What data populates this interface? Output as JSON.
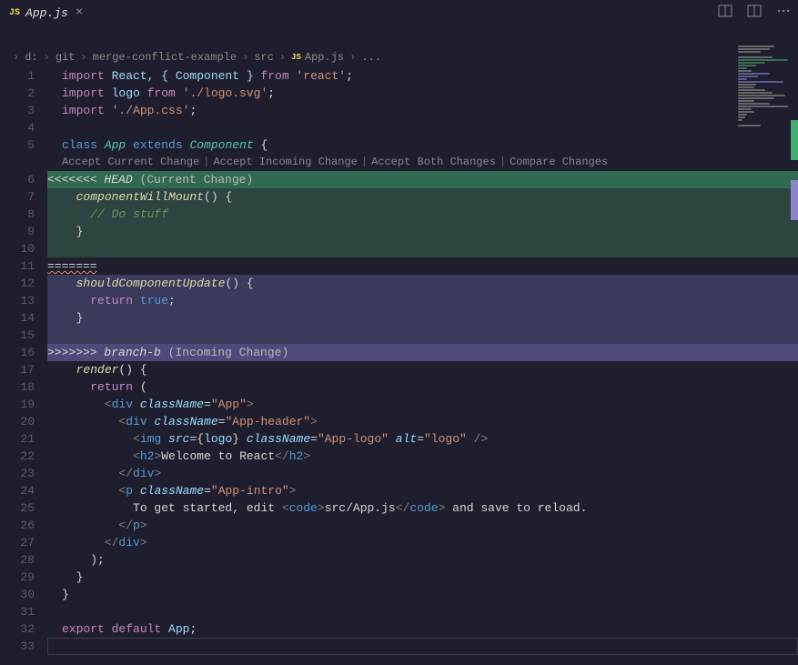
{
  "tab": {
    "icon_text": "JS",
    "filename": "App.js"
  },
  "top_icons": {
    "split": "split-editor",
    "layout": "editor-layout",
    "more": "more-actions"
  },
  "breadcrumb": {
    "items": [
      "d:",
      "git",
      "merge-conflict-example",
      "src"
    ],
    "file_icon": "JS",
    "file": "App.js",
    "trailing": "..."
  },
  "codelens": {
    "accept_current": "Accept Current Change",
    "accept_incoming": "Accept Incoming Change",
    "accept_both": "Accept Both Changes",
    "compare": "Compare Changes"
  },
  "conflict": {
    "head_marker": "<<<<<<< ",
    "head_label": "HEAD",
    "head_suffix": " (Current Change)",
    "separator": "=======",
    "incoming_marker": ">>>>>>> ",
    "incoming_label": "branch-b",
    "incoming_suffix": " (Incoming Change)"
  },
  "lines": {
    "l1_kw": "import",
    "l1_rest": " React, { Component } ",
    "l1_from": "from",
    "l1_str": " 'react'",
    "l2_kw": "import",
    "l2_var": " logo ",
    "l2_from": "from",
    "l2_str": " './logo.svg'",
    "l3_kw": "import",
    "l3_str": " './App.css'",
    "l5_class": "class",
    "l5_name": " App ",
    "l5_extends": "extends",
    "l5_comp": " Component ",
    "l7_fn": "componentWillMount",
    "l8_com": "// Do stuff",
    "l12_fn": "shouldComponentUpdate",
    "l13_ret": "return",
    "l13_true": " true",
    "l17_fn": "render",
    "l18_ret": "return",
    "l19_div": "div",
    "l19_cn": "className",
    "l19_val": "\"App\"",
    "l20_div": "div",
    "l20_cn": "className",
    "l20_val": "\"App-header\"",
    "l21_img": "img",
    "l21_src": "src",
    "l21_logo": "logo",
    "l21_cn": "className",
    "l21_val": "\"App-logo\"",
    "l21_alt": "alt",
    "l21_altval": "\"logo\"",
    "l22_h2": "h2",
    "l22_text": "Welcome to React",
    "l23_div": "div",
    "l24_p": "p",
    "l24_cn": "className",
    "l24_val": "\"App-intro\"",
    "l25_text1": "To get started, edit ",
    "l25_code": "code",
    "l25_text2": "src/App.js",
    "l25_text3": " and save to reload.",
    "l26_p": "p",
    "l27_div": "div",
    "l32_export": "export",
    "l32_default": " default",
    "l32_app": " App"
  },
  "colors": {
    "current_bg": "#3a6b52",
    "incoming_bg": "#5a5a8f",
    "ruler_green": "#3fae6f",
    "ruler_purple": "#8d84cc"
  }
}
